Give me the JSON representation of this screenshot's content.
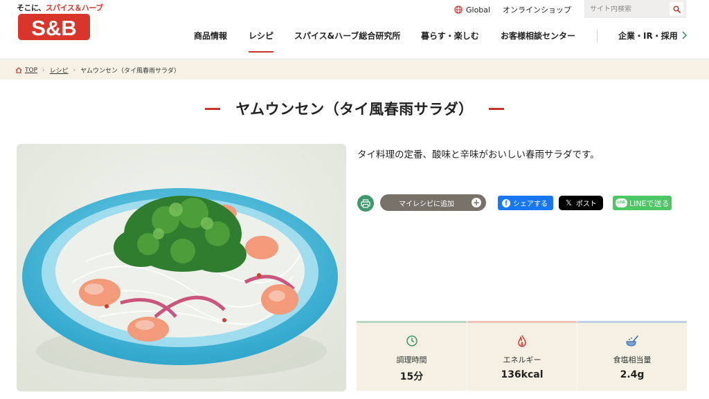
{
  "header": {
    "tagline_prefix": "そこに、",
    "tagline_highlight": "スパイス＆ハーブ",
    "logo_text": "S&B",
    "global_label": "Global",
    "shop_label": "オンラインショップ",
    "search_placeholder": "サイト内検索",
    "nav": [
      {
        "label": "商品情報",
        "active": false
      },
      {
        "label": "レシピ",
        "active": true
      },
      {
        "label": "スパイス&ハーブ総合研究所",
        "active": false
      },
      {
        "label": "暮らす・楽しむ",
        "active": false
      },
      {
        "label": "お客様相談センター",
        "active": false
      },
      {
        "label": "企業・IR・採用",
        "active": false
      }
    ],
    "colors": {
      "brand_red": "#d8362b",
      "active_underline": "#c9342a"
    }
  },
  "breadcrumb": [
    "TOP",
    "レシピ",
    "ヤムウンセン（タイ風春雨サラダ）"
  ],
  "page": {
    "title": "ヤムウンセン（タイ風春雨サラダ）",
    "description": "タイ料理の定番、酸味と辛味がおいしい春雨サラダです。"
  },
  "actions": {
    "print_icon": "print-icon",
    "my_recipe_label": "マイレシピに追加",
    "facebook_label": "シェアする",
    "x_label": "ポスト",
    "line_label": "LINEで送る"
  },
  "info": [
    {
      "icon": "clock-icon",
      "label": "調理時間",
      "value": "15分",
      "accent": "#b9d8c4"
    },
    {
      "icon": "flame-icon",
      "label": "エネルギー",
      "value": "136kcal",
      "accent": "#f0c4b6"
    },
    {
      "icon": "salt-spoon-icon",
      "label": "食塩相当量",
      "value": "2.4g",
      "accent": "#bcd0e6"
    }
  ],
  "photo": {
    "subject": "food-photo",
    "colors": {
      "bowl": "#45b7d6",
      "background": "#e9ece4"
    }
  }
}
